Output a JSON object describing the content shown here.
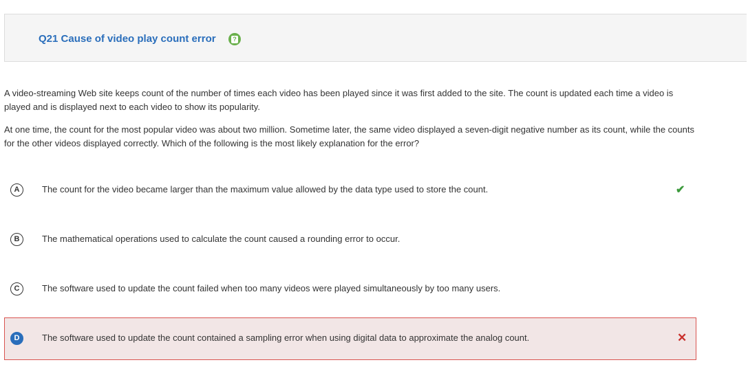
{
  "question": {
    "title": "Q21 Cause of video play count error",
    "help_icon": "help-icon"
  },
  "stem": {
    "paragraph_1": "A video-streaming Web site keeps count of the number of times each video has been played since it was first added to the site. The count is updated each time a video is played and is displayed next to each video to show its popularity.",
    "paragraph_2": "At one time, the count for the most popular video was about two million. Sometime later, the same video displayed a seven-digit negative number as its count, while the counts for the other videos displayed correctly. Which of the following is the most likely explanation for the error?"
  },
  "choices": [
    {
      "letter": "A",
      "text": "The count for the video became larger than the maximum value allowed by the data type used to store the count.",
      "mark": "✔",
      "status": "correct"
    },
    {
      "letter": "B",
      "text": "The mathematical operations used to calculate the count caused a rounding error to occur.",
      "mark": "",
      "status": "none"
    },
    {
      "letter": "C",
      "text": "The software used to update the count failed when too many videos were played simultaneously by too many users.",
      "mark": "",
      "status": "none"
    },
    {
      "letter": "D",
      "text": "The software used to update the count contained a sampling error when using digital data to approximate the analog count.",
      "mark": "✕",
      "status": "incorrect-selected"
    }
  ],
  "colors": {
    "accent": "#2a6ebb",
    "correct": "#3c9a3c",
    "incorrect": "#c9302c",
    "incorrect_bg": "#f2e6e6"
  }
}
